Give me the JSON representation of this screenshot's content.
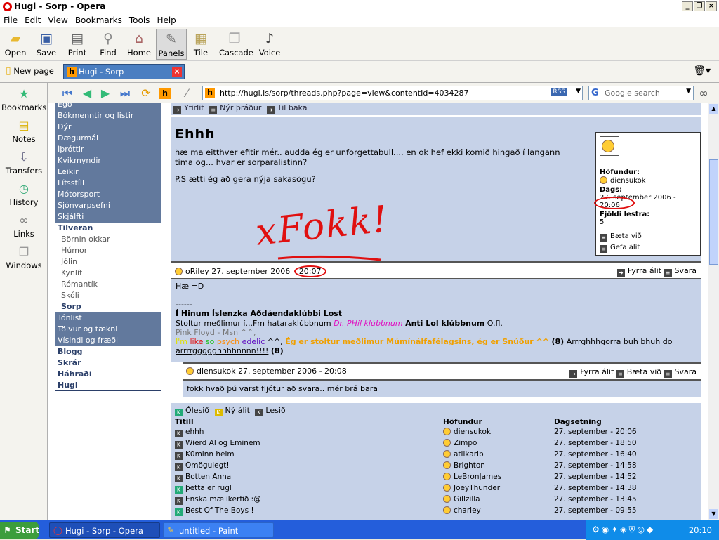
{
  "window": {
    "title": "Hugi - Sorp - Opera"
  },
  "menu": [
    "File",
    "Edit",
    "View",
    "Bookmarks",
    "Tools",
    "Help"
  ],
  "toolbar": [
    "Open",
    "Save",
    "Print",
    "Find",
    "Home",
    "Panels",
    "Tile",
    "Cascade",
    "Voice"
  ],
  "tabs": {
    "new_page": "New page",
    "active_tab": "Hugi - Sorp"
  },
  "panels": [
    "Bookmarks",
    "Notes",
    "Transfers",
    "History",
    "Links",
    "Windows"
  ],
  "address": {
    "url": "http://hugi.is/sorp/threads.php?page=view&contentId=4034287",
    "rss": "RSS",
    "search_placeholder": "Google search",
    "search_logo": "G"
  },
  "sidenav": {
    "cut_top": "Ego",
    "dark_items": [
      "Bókmenntir og listir",
      "Dýr",
      "Dægurmál",
      "Íþróttir",
      "Kvikmyndir",
      "Leikir",
      "Lífsstíll",
      "Mótorsport",
      "Sjónvarpsefni",
      "Skjálfti"
    ],
    "tilveran": "Tilveran",
    "sub_items": [
      "Börnin okkar",
      "Húmor",
      "Jólin",
      "Kynlíf",
      "Rómantík",
      "Skóli"
    ],
    "current": "Sorp",
    "dark_items2": [
      "Tónlist",
      "Tölvur og tækni",
      "Vísindi og fræði"
    ],
    "bottom": [
      "Blogg",
      "Skrár",
      "Háhraði",
      "Hugi"
    ]
  },
  "thread": {
    "crumbs": [
      "Yfirlit",
      "Nýr þráður",
      "Til baka"
    ],
    "title": "Ehhh",
    "body_1": "hæ ma eitthver efitir mér.. audda ég er unforgettabull.... en ok hef ekki komið hingað í langann tíma og... hvar er sorparalistinn?",
    "body_2": "P.S ætti ég að gera nýja sakasögu?",
    "drawing": "xFokk!",
    "info": {
      "author_label": "Höfundur:",
      "author": "diensukok",
      "date_label": "Dags:",
      "date_text": "27. september 2006 - 20:06",
      "reads_label": "Fjöldi lestra:",
      "reads": "5",
      "action_1": "Bæta við",
      "action_2": "Gefa álit"
    }
  },
  "reply_1": {
    "user": "oRiley",
    "date": "27. september 2006",
    "time": "20:07",
    "prev": "Fyrra álit",
    "answer": "Svara",
    "lines": [
      "Hæ =D",
      "------"
    ],
    "sig_bold": "Í Hinum Íslenzka Aðdáendaklúbbi Lost",
    "sig_line2_a": "Stoltur meðlimur í...",
    "sig_line2_b": "Fm hataraklúbbnum",
    "sig_line2_c": "Dr. PHil klúbbnum",
    "sig_line2_d": "Anti Lol klúbbnum",
    "sig_line2_e": "O.fl.",
    "sig_line3": "Pink Floyd - Msn ^^,",
    "sig_line4_a": "I'm",
    "sig_line4_b": "like",
    "sig_line4_c": "so",
    "sig_line4_d": "psych",
    "sig_line4_e": "edelic",
    "sig_line4_f": "^^,",
    "sig_line4_g": "Ég er stoltur meðlimur Múmínálfafélagsins, ég er Snúður ^^",
    "sig_line4_h": "(8)",
    "sig_line4_i": "Arrrghhhgorra buh bhuh do arrrrggggghhhhnnnn!!!!",
    "sig_line4_j": "(8)"
  },
  "reply_2": {
    "user": "diensukok",
    "date": "27. september 2006 - 20:08",
    "prev": "Fyrra álit",
    "add": "Bæta við",
    "answer": "Svara",
    "text": "fokk hvað þú varst fljótur að svara.. mér brá bara"
  },
  "legend": [
    "Ólesið",
    "Ný álit",
    "Lesið"
  ],
  "table": {
    "headers": [
      "Titill",
      "Höfundur",
      "Dagsetning"
    ],
    "rows": [
      {
        "title": "ehhh",
        "author": "diensukok",
        "date": "27. september - 20:06"
      },
      {
        "title": "Wierd Al og Eminem",
        "author": "Zimpo",
        "date": "27. september - 18:50"
      },
      {
        "title": "K0minn heim",
        "author": "atlikarlb",
        "date": "27. september - 16:40"
      },
      {
        "title": "Ómögulegt!",
        "author": "Brighton",
        "date": "27. september - 14:58"
      },
      {
        "title": "Botten Anna",
        "author": "LeBronJames",
        "date": "27. september - 14:52"
      },
      {
        "title": "þetta er rugl",
        "author": "JoeyThunder",
        "date": "27. september - 14:38"
      },
      {
        "title": "Enska mælikerfið :@",
        "author": "Gillzilla",
        "date": "27. september - 13:45"
      },
      {
        "title": "Best Of The Boys !",
        "author": "charley",
        "date": "27. september - 09:55"
      }
    ]
  },
  "taskbar": {
    "start": "Start",
    "task_1": "Hugi - Sorp - Opera",
    "task_2": "untitled - Paint",
    "clock": "20:10"
  }
}
